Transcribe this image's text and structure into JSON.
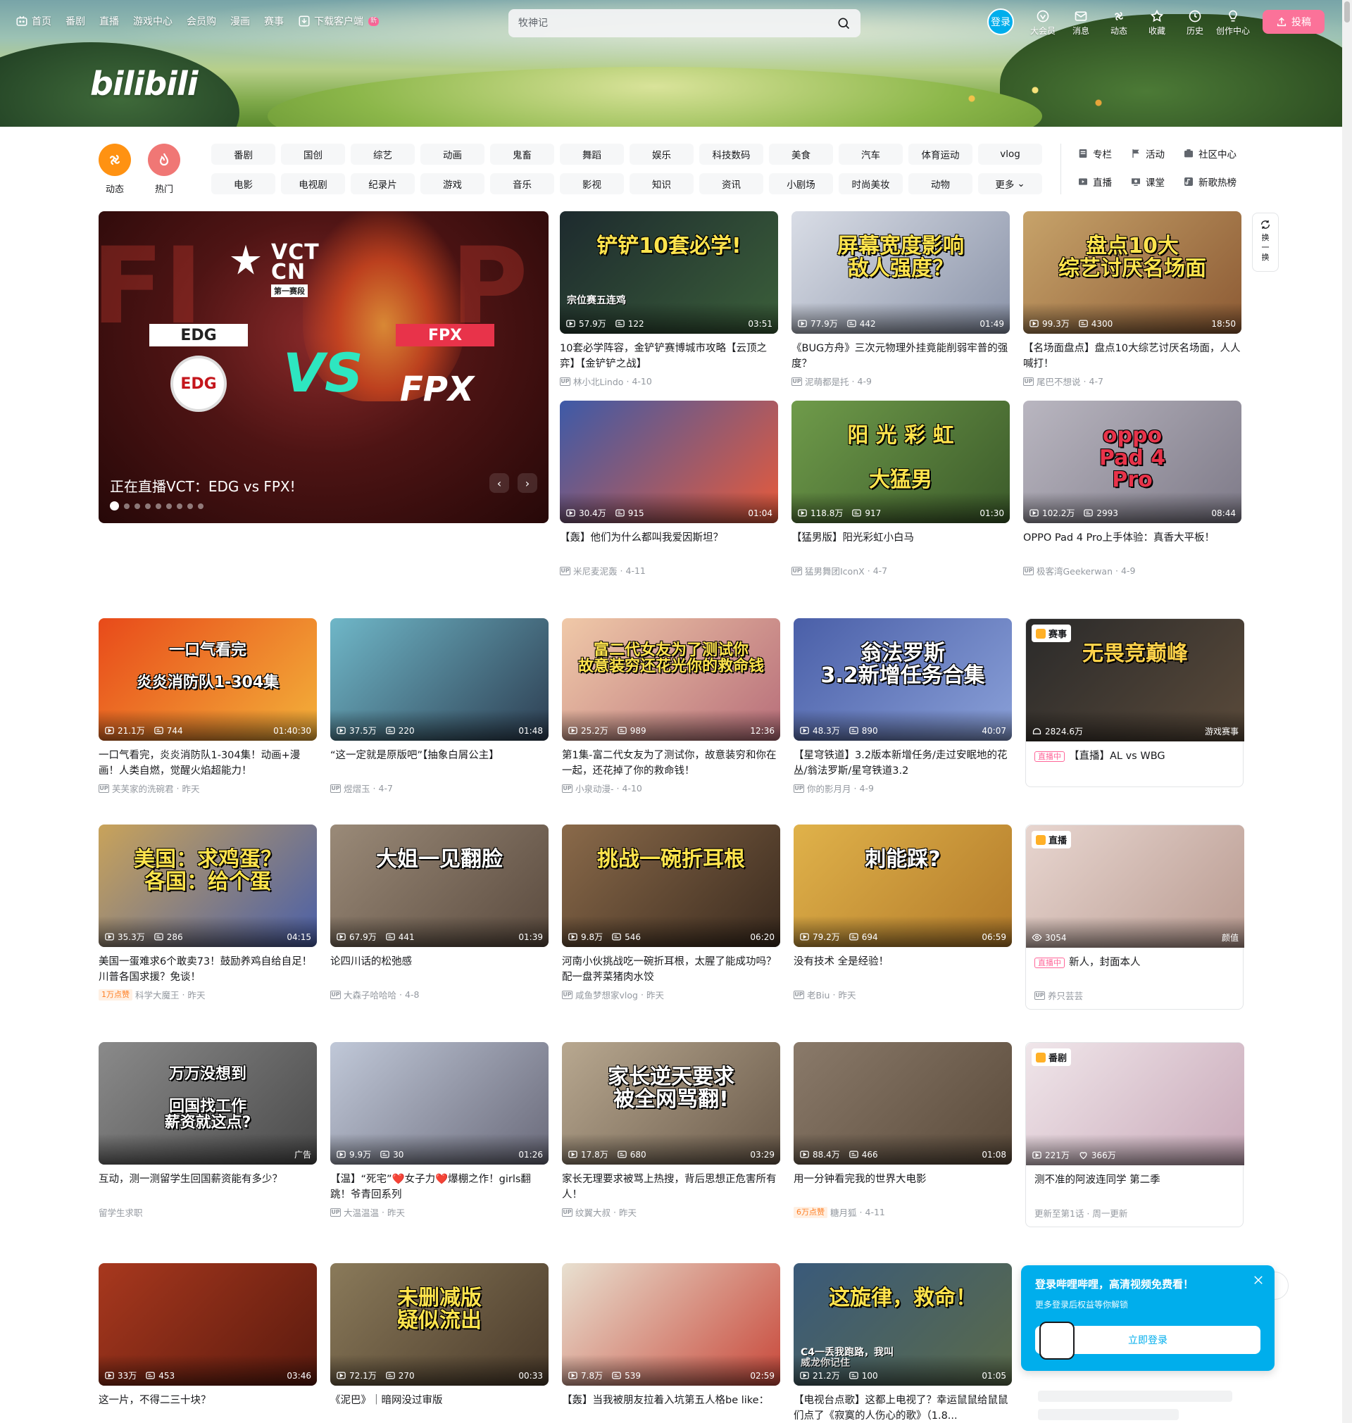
{
  "header": {
    "nav": [
      {
        "label": "首页",
        "icon": "bilibili-tv-icon"
      },
      {
        "label": "番剧"
      },
      {
        "label": "直播"
      },
      {
        "label": "游戏中心"
      },
      {
        "label": "会员购"
      },
      {
        "label": "漫画"
      },
      {
        "label": "赛事"
      },
      {
        "label": "下载客户端",
        "icon": "download-icon",
        "badge": "新"
      }
    ],
    "logo": "bilibili",
    "search_placeholder": "牧神记",
    "login": "登录",
    "right_nav": [
      {
        "label": "大会员",
        "icon": "vip-icon"
      },
      {
        "label": "消息",
        "icon": "message-icon"
      },
      {
        "label": "动态",
        "icon": "dynamic-icon"
      },
      {
        "label": "收藏",
        "icon": "favorite-icon"
      },
      {
        "label": "历史",
        "icon": "history-icon"
      },
      {
        "label": "创作中心",
        "icon": "creator-icon"
      }
    ],
    "upload": "投稿"
  },
  "channels": {
    "icons": [
      {
        "label": "动态",
        "color": "#ff9212"
      },
      {
        "label": "热门",
        "color": "#f07775"
      }
    ],
    "items": [
      "番剧",
      "国创",
      "综艺",
      "动画",
      "鬼畜",
      "舞蹈",
      "娱乐",
      "科技数码",
      "美食",
      "汽车",
      "体育运动",
      "vlog",
      "电影",
      "电视剧",
      "纪录片",
      "游戏",
      "音乐",
      "影视",
      "知识",
      "资讯",
      "小剧场",
      "时尚美妆",
      "动物",
      "更多"
    ],
    "side_links": [
      {
        "label": "专栏",
        "icon": "column-icon"
      },
      {
        "label": "活动",
        "icon": "activity-icon"
      },
      {
        "label": "社区中心",
        "icon": "community-icon"
      },
      {
        "label": "直播",
        "icon": "live-icon"
      },
      {
        "label": "课堂",
        "icon": "classroom-icon"
      },
      {
        "label": "新歌热榜",
        "icon": "music-chart-icon"
      }
    ]
  },
  "carousel": {
    "title": "正在直播VCT：EDG vs FPX!",
    "vct_line1": "VCT",
    "vct_line2": "CN",
    "vct_stage": "第一赛段",
    "team1": "EDG",
    "team2": "FPX",
    "vs": "VS",
    "dots": 9,
    "active_dot": 0
  },
  "refresh_label": "换一换",
  "cards": [
    {
      "id": "c1",
      "title": "10套必学阵容，金铲铲赛博城市攻略【云顶之弈】【金铲铲之战】",
      "views": "57.9万",
      "danmaku": "122",
      "duration": "03:51",
      "up": "林小北Lindo",
      "date": "4-10",
      "thumb_text": "铲铲10套必学!",
      "thumb_sub": "宗位赛五连鸡",
      "bg": [
        "#1d2a2e",
        "#3b5f3a"
      ],
      "tcolor": "#ffe44d"
    },
    {
      "id": "c2",
      "title": "《BUG方舟》三次元物理外挂竟能削弱牢普的强度？",
      "views": "77.9万",
      "danmaku": "442",
      "duration": "01:49",
      "up": "泥萌都是托",
      "date": "4-9",
      "thumb_text": "屏幕宽度影响\n敌人强度？",
      "bg": [
        "#d9dde6",
        "#8a93a8"
      ],
      "tcolor": "#ffe44d"
    },
    {
      "id": "c3",
      "title": "【名场面盘点】盘点10大综艺讨厌名场面，人人喊打！",
      "views": "99.3万",
      "danmaku": "4300",
      "duration": "18:50",
      "up": "尾巴不想说",
      "date": "4-7",
      "thumb_text": "盘点10大\n综艺讨厌名场面",
      "bg": [
        "#c7a36a",
        "#8c5a34"
      ],
      "tcolor": "#ffe44d"
    },
    {
      "id": "c4",
      "title": "【轰】他们为什么都叫我爱因斯坦？",
      "views": "30.4万",
      "danmaku": "915",
      "duration": "01:04",
      "up": "米尼麦泥轰",
      "date": "4-11",
      "thumb_text": "",
      "bg": [
        "#3d5aa8",
        "#e85a3a"
      ],
      "tcolor": "#fff"
    },
    {
      "id": "c5",
      "title": "【猛男版】阳光彩虹小白马",
      "views": "118.8万",
      "danmaku": "917",
      "duration": "01:30",
      "up": "猛男舞团IconX",
      "date": "4-7",
      "thumb_text": "阳 光 彩 虹\n\n大猛男",
      "bg": [
        "#6f9b4a",
        "#3b5a2a"
      ],
      "tcolor": "#ffe44d"
    },
    {
      "id": "c6",
      "title": "OPPO Pad 4 Pro上手体验：真香大平板！",
      "views": "102.2万",
      "danmaku": "2993",
      "duration": "08:44",
      "up": "极客湾Geekerwan",
      "date": "4-9",
      "thumb_text": "oppo\nPad 4\nPro",
      "bg": [
        "#b9b6c0",
        "#7e7a88"
      ],
      "tcolor": "#e8334a"
    },
    {
      "id": "c7",
      "title": "一口气看完，炎炎消防队1-304集！动画+漫画！人类自燃，觉醒火焰超能力！",
      "views": "21.1万",
      "danmaku": "744",
      "duration": "01:40:30",
      "up": "芙芙家的洗碗君",
      "date": "昨天",
      "thumb_text": "一口气看完\n\n炎炎消防队1-304集",
      "bg": [
        "#e84a1a",
        "#f3b13a"
      ],
      "tcolor": "#ffffff"
    },
    {
      "id": "c8",
      "title": "“这一定就是原版吧”【抽象白屑公主】",
      "views": "37.5万",
      "danmaku": "220",
      "duration": "01:48",
      "up": "煜熠玉",
      "date": "4-7",
      "thumb_text": "",
      "bg": [
        "#6fb7c8",
        "#2d3e52"
      ],
      "tcolor": "#fff"
    },
    {
      "id": "c9",
      "title": "第1集-富二代女友为了测试你，故意装穷和你在一起，还花掉了你的救命钱！",
      "views": "25.2万",
      "danmaku": "989",
      "duration": "12:36",
      "up": "小泉动漫-",
      "date": "4-10",
      "thumb_text": "富二代女友为了测试你\n故意装穷还花光你的救命钱",
      "bg": [
        "#f0c9a8",
        "#b76e7a"
      ],
      "tcolor": "#ffe44d"
    },
    {
      "id": "c10",
      "title": "【星穹铁道】3.2版本新增任务/走过安眠地的花丛/翁法罗斯/星穹铁道3.2",
      "views": "48.3万",
      "danmaku": "890",
      "duration": "40:07",
      "up": "你的影月月",
      "date": "4-9",
      "thumb_text": "翁法罗斯\n3.2新增任务合集",
      "bg": [
        "#4a5fa8",
        "#8aa0d8"
      ],
      "tcolor": "#ffffff"
    },
    {
      "id": "c11",
      "title": "【直播】AL vs WBG",
      "views": "2824.6万",
      "danmaku": "",
      "duration": "游戏赛事",
      "up": "",
      "date": "",
      "thumb_text": "无畏竞巅峰",
      "tag": "赛事",
      "live": "直播中",
      "bg": [
        "#2a2a2a",
        "#5a4a3a"
      ],
      "tcolor": "#ffd24a",
      "boxed": true
    },
    {
      "id": "c12",
      "title": "美国一蛋难求6个敢卖73！鼓励养鸡自给自足！川普各国求援？免谈！",
      "views": "35.3万",
      "danmaku": "286",
      "duration": "04:15",
      "up": "科学大魔王",
      "date": "昨天",
      "hot": "1万点赞",
      "thumb_text": "美国：求鸡蛋？\n各国：给个蛋",
      "bg": [
        "#c9a35a",
        "#4a5fa8"
      ],
      "tcolor": "#ffe44d"
    },
    {
      "id": "c13",
      "title": "论四川话的松弛感",
      "views": "67.9万",
      "danmaku": "441",
      "duration": "01:39",
      "up": "大森子哈哈哈",
      "date": "4-8",
      "thumb_text": "大姐一见翻脸",
      "bg": [
        "#9a8a78",
        "#5a4a3e"
      ],
      "tcolor": "#ffffff"
    },
    {
      "id": "c14",
      "title": "河南小伙挑战吃一碗折耳根，太腥了能成功吗？配一盘荠菜猪肉水饺",
      "views": "9.8万",
      "danmaku": "546",
      "duration": "06:20",
      "up": "咸鱼梦想家vlog",
      "date": "昨天",
      "thumb_text": "挑战一碗折耳根",
      "bg": [
        "#8a6a4a",
        "#3a2a1e"
      ],
      "tcolor": "#ffe44d"
    },
    {
      "id": "c15",
      "title": "没有技术 全是经验！",
      "views": "79.2万",
      "danmaku": "694",
      "duration": "06:59",
      "up": "老Biu",
      "date": "昨天",
      "thumb_text": "刺能踩?",
      "bg": [
        "#e0b24a",
        "#b27a2a"
      ],
      "tcolor": "#ffffff"
    },
    {
      "id": "c16",
      "title": "新人，封面本人",
      "views": "3054",
      "danmaku": "",
      "duration": "颜值",
      "up": "养只芸芸",
      "date": "",
      "thumb_text": "",
      "tag": "直播",
      "live": "直播中",
      "bg": [
        "#e8d6d0",
        "#b89a90"
      ],
      "tcolor": "#fff",
      "boxed": true
    },
    {
      "id": "c17",
      "title": "互动，测一测留学生回国薪资能有多少？",
      "views": "",
      "danmaku": "",
      "duration": "广告",
      "up": "留学生求职",
      "date": "",
      "thumb_text": "万万没想到\n\n回国找工作\n薪资就这点?",
      "bg": [
        "#8a8a8a",
        "#4a4a4a"
      ],
      "tcolor": "#ffffff",
      "ad": true
    },
    {
      "id": "c18",
      "title": "【温】“死宅”❤️女子力❤️爆棚之作！girls翻跳！爷青回系列",
      "views": "9.9万",
      "danmaku": "30",
      "duration": "01:26",
      "up": "大温温温",
      "date": "昨天",
      "thumb_text": "",
      "bg": [
        "#c0c8d8",
        "#6a6a7a"
      ],
      "tcolor": "#fff"
    },
    {
      "id": "c19",
      "title": "家长无理要求被骂上热搜，背后思想正危害所有人！",
      "views": "17.8万",
      "danmaku": "680",
      "duration": "03:29",
      "up": "纹翼大叔",
      "date": "昨天",
      "thumb_text": "家长逆天要求\n被全网骂翻!",
      "bg": [
        "#b8a890",
        "#6a5a4a"
      ],
      "tcolor": "#ffffff"
    },
    {
      "id": "c20",
      "title": "用一分钟看完我的世界大电影",
      "views": "88.4万",
      "danmaku": "466",
      "duration": "01:08",
      "up": "糖月狐",
      "date": "4-11",
      "hot": "6万点赞",
      "thumb_text": "",
      "bg": [
        "#8a7a6a",
        "#5a4a3a"
      ],
      "tcolor": "#fff"
    },
    {
      "id": "c21",
      "title": "测不准的阿波连同学 第二季",
      "views": "221万",
      "danmaku": "366万",
      "duration": "",
      "up": "更新至第1话 · 周一更新",
      "date": "",
      "thumb_text": "",
      "tag": "番剧",
      "bg": [
        "#f0e6ea",
        "#c8a8b8"
      ],
      "tcolor": "#fff",
      "boxed": true,
      "follow": true
    },
    {
      "id": "c22",
      "title": "这一片，不得二三十块？",
      "views": "33万",
      "danmaku": "453",
      "duration": "03:46",
      "up": "",
      "date": "",
      "thumb_text": "",
      "bg": [
        "#a8381e",
        "#5a1a0e"
      ],
      "tcolor": "#fff"
    },
    {
      "id": "c23",
      "title": "《泥巴》｜暗网没过审版",
      "views": "72.1万",
      "danmaku": "270",
      "duration": "00:33",
      "up": "",
      "date": "",
      "thumb_text": "未删减版\n疑似流出",
      "bg": [
        "#8a7a5a",
        "#4a3a2a"
      ],
      "tcolor": "#ffe44d"
    },
    {
      "id": "c24",
      "title": "【轰】当我被朋友拉着入坑第五人格be like：",
      "views": "7.8万",
      "danmaku": "539",
      "duration": "02:59",
      "up": "",
      "date": "",
      "thumb_text": "",
      "bg": [
        "#e8e0d0",
        "#c8483a"
      ],
      "tcolor": "#fff"
    },
    {
      "id": "c25",
      "title": "【电视台点歌】这都上电视了？幸运鼠鼠给鼠鼠们点了《寂寞的人伤心的歌》（1.8...",
      "views": "21.2万",
      "danmaku": "100",
      "duration": "01:05",
      "up": "",
      "date": "",
      "thumb_text": "这旋律，救命！",
      "thumb_sub": "C4一丢我跑路，我叫\n威龙你记住",
      "bg": [
        "#3a5a7a",
        "#5a6a4a"
      ],
      "tcolor": "#ffe44d"
    }
  ],
  "login_popup": {
    "title": "登录哔哩哔哩，高清视频免费看！",
    "subtitle": "更多登录后权益等你解锁",
    "button": "立即登录"
  }
}
